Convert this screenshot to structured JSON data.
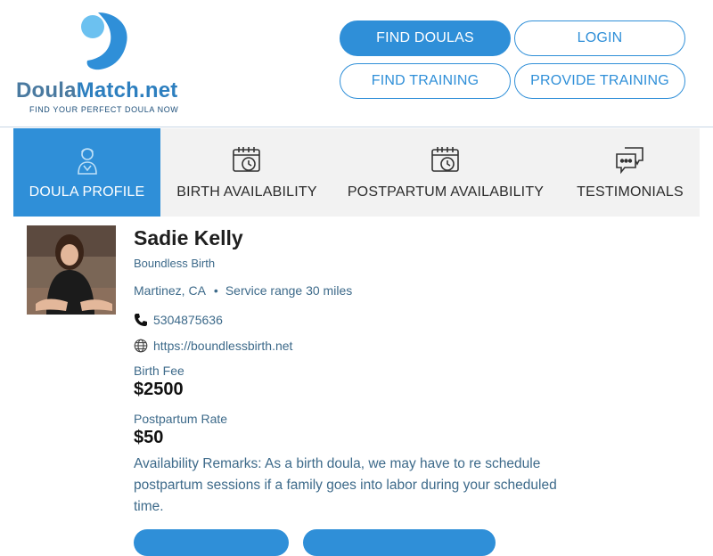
{
  "brand": {
    "name_part1": "Doula",
    "name_part2": "Match.net",
    "tagline": "FIND YOUR PERFECT DOULA NOW"
  },
  "nav": {
    "find_doulas": "FIND DOULAS",
    "login": "LOGIN",
    "find_training": "FIND TRAINING",
    "provide_training": "PROVIDE TRAINING"
  },
  "tabs": [
    {
      "label": "DOULA PROFILE",
      "icon": "doula-person-icon",
      "active": true
    },
    {
      "label": "BIRTH AVAILABILITY",
      "icon": "calendar-clock-icon",
      "active": false
    },
    {
      "label": "POSTPARTUM AVAILABILITY",
      "icon": "calendar-clock-icon",
      "active": false
    },
    {
      "label": "TESTIMONIALS",
      "icon": "chat-bubbles-icon",
      "active": false
    }
  ],
  "profile": {
    "name": "Sadie Kelly",
    "organization": "Boundless Birth",
    "location": "Martinez, CA",
    "service_range": "Service range 30 miles",
    "phone": "5304875636",
    "website": "https://boundlessbirth.net",
    "birth_fee_label": "Birth Fee",
    "birth_fee": "$2500",
    "postpartum_rate_label": "Postpartum Rate",
    "postpartum_rate": "$50",
    "remarks": "Availability Remarks: As a birth doula, we may have to re schedule postpartum sessions if a family goes into labor during your scheduled time."
  },
  "colors": {
    "accent": "#2f8fd8",
    "text_secondary": "#3d6a8a",
    "tab_bg": "#f2f2f2"
  }
}
